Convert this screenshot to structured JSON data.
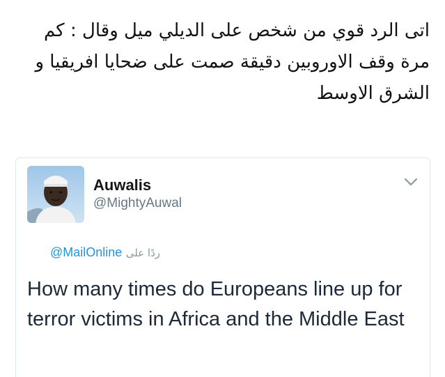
{
  "caption": {
    "text": "اتى الرد قوي من شخص على الديلي ميل وقال : كم مرة وقف الاوروبين دقيقة صمت على ضحايا افريقيا و الشرق الاوسط"
  },
  "tweet": {
    "avatar_icon": "user-avatar-photo",
    "display_name": "Auwalis",
    "handle": "@MightyAuwal",
    "menu_icon": "chevron-down-icon",
    "reply_label": "ردًا على",
    "reply_mention": "@MailOnline",
    "text": "How many times do Europeans line up for terror victims in Africa and the Middle East"
  },
  "colors": {
    "link": "#1b95e0",
    "secondary_text": "#657786",
    "border": "#e1e8ed"
  }
}
